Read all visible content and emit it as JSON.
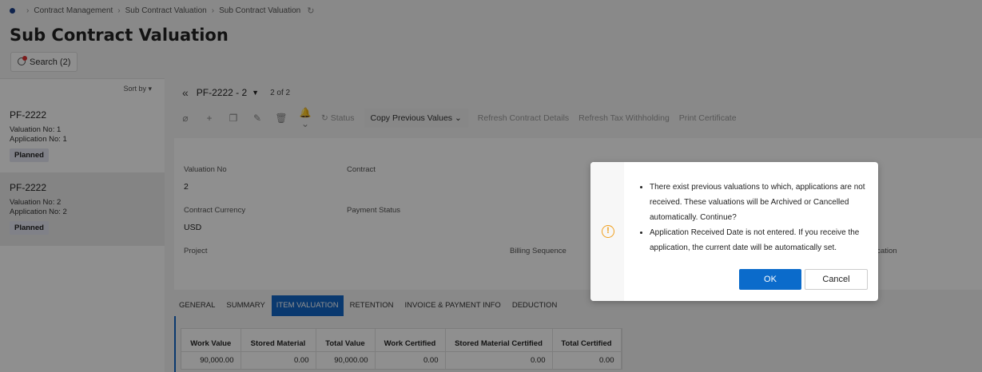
{
  "breadcrumb": {
    "items": [
      "Contract Management",
      "Sub Contract Valuation",
      "Sub Contract Valuation"
    ]
  },
  "page": {
    "title": "Sub Contract Valuation",
    "search_label": "Search (2)"
  },
  "left_panel": {
    "sort_label": "Sort by",
    "cards": [
      {
        "id": "PF-2222",
        "valuation": "Valuation No:  1",
        "application": "Application No:  1",
        "status": "Planned"
      },
      {
        "id": "PF-2222",
        "valuation": "Valuation No:  2",
        "application": "Application No:  2",
        "status": "Planned"
      }
    ]
  },
  "record_nav": {
    "record_id": "PF-2222 - 2",
    "position": "2 of 2"
  },
  "toolbar": {
    "status": "Status",
    "copy_previous": "Copy Previous Values",
    "refresh_contract": "Refresh Contract Details",
    "refresh_tax": "Refresh Tax Withholding",
    "print_certificate": "Print Certificate"
  },
  "form": {
    "valuation_no_label": "Valuation No",
    "valuation_no_value": "2",
    "contract_label": "Contract",
    "contract_currency_label": "Contract Currency",
    "contract_currency_value": "USD",
    "payment_status_label": "Payment Status",
    "project_label": "Project",
    "billing_sequence_label": "Billing Sequence",
    "partial_label": "lication"
  },
  "tabs": [
    "GENERAL",
    "SUMMARY",
    "ITEM VALUATION",
    "RETENTION",
    "INVOICE & PAYMENT INFO",
    "DEDUCTION"
  ],
  "table": {
    "headers": [
      "Work Value",
      "Stored Material",
      "Total Value",
      "Work Certified",
      "Stored Material Certified",
      "Total Certified"
    ],
    "rows": [
      [
        "90,000.00",
        "0.00",
        "90,000.00",
        "0.00",
        "0.00",
        "0.00"
      ]
    ]
  },
  "dialog": {
    "messages": [
      "There exist previous valuations to which, applications are not received. These valuations will be Archived or Cancelled automatically. Continue?",
      "Application Received Date is not entered. If you receive the application, the current date will be automatically set."
    ],
    "ok_label": "OK",
    "cancel_label": "Cancel"
  },
  "colors": {
    "primary": "#0b6bcb",
    "tab_active": "#1367c7",
    "warning": "#f0a020"
  }
}
